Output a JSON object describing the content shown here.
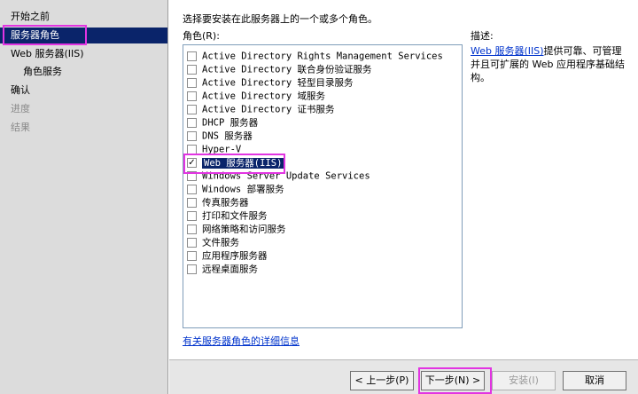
{
  "nav": {
    "items": [
      {
        "label": "开始之前",
        "state": "normal"
      },
      {
        "label": "服务器角色",
        "state": "selected"
      },
      {
        "label": "Web 服务器(IIS)",
        "state": "normal"
      },
      {
        "label": "角色服务",
        "state": "sub"
      },
      {
        "label": "确认",
        "state": "normal"
      },
      {
        "label": "进度",
        "state": "disabled"
      },
      {
        "label": "结果",
        "state": "disabled"
      }
    ]
  },
  "main": {
    "instruction": "选择要安装在此服务器上的一个或多个角色。",
    "roles_label": "角色(R):",
    "description_label": "描述:",
    "description_link": "Web 服务器(IIS)",
    "description_text": "提供可靠、可管理并且可扩展的 Web 应用程序基础结构。",
    "more_info_link": "有关服务器角色的详细信息"
  },
  "roles": [
    {
      "label": "Active Directory Rights Management Services",
      "checked": false
    },
    {
      "label": "Active Directory 联合身份验证服务",
      "checked": false
    },
    {
      "label": "Active Directory 轻型目录服务",
      "checked": false
    },
    {
      "label": "Active Directory 域服务",
      "checked": false
    },
    {
      "label": "Active Directory 证书服务",
      "checked": false
    },
    {
      "label": "DHCP 服务器",
      "checked": false
    },
    {
      "label": "DNS 服务器",
      "checked": false
    },
    {
      "label": "Hyper-V",
      "checked": false
    },
    {
      "label": "Web 服务器(IIS)",
      "checked": true,
      "selected": true
    },
    {
      "label": "Windows Server Update Services",
      "checked": false
    },
    {
      "label": "Windows 部署服务",
      "checked": false
    },
    {
      "label": "传真服务器",
      "checked": false
    },
    {
      "label": "打印和文件服务",
      "checked": false
    },
    {
      "label": "网络策略和访问服务",
      "checked": false
    },
    {
      "label": "文件服务",
      "checked": false
    },
    {
      "label": "应用程序服务器",
      "checked": false
    },
    {
      "label": "远程桌面服务",
      "checked": false
    }
  ],
  "buttons": {
    "prev": "< 上一步(P)",
    "next": "下一步(N) >",
    "install": "安装(I)",
    "cancel": "取消"
  },
  "colors": {
    "selection": "#0a246a",
    "highlight_box": "#e234e2",
    "link": "#0033cc"
  }
}
